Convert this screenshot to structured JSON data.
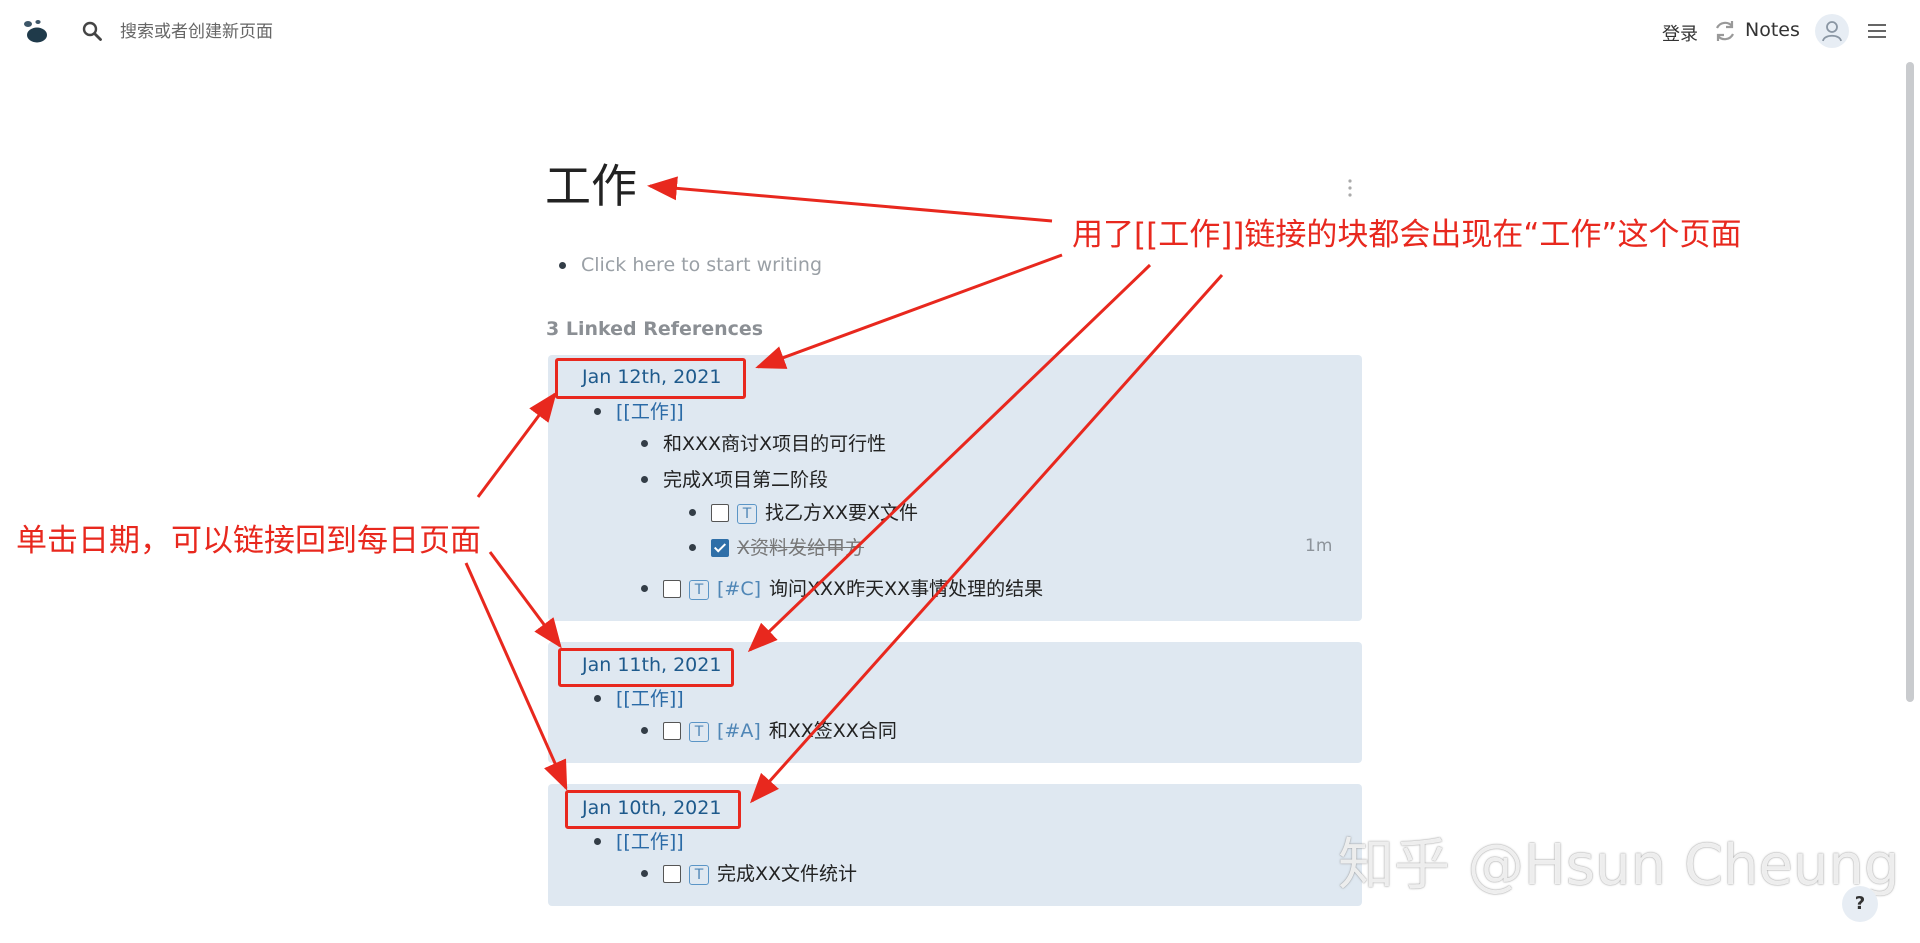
{
  "topbar": {
    "search_placeholder": "搜索或者创建新页面",
    "login": "登录",
    "notes": "Notes"
  },
  "page": {
    "title": "工作",
    "placeholder": "Click here to start writing",
    "refs_heading": "3 Linked References"
  },
  "references": [
    {
      "date": "Jan 12th, 2021",
      "parent": "[[工作]]",
      "items": [
        {
          "text": "和XXX商讨X项目的可行性"
        },
        {
          "text": "完成X项目第二阶段",
          "children": [
            {
              "marker": "T",
              "text": "找乙方XX要X文件",
              "checked": false
            },
            {
              "text": "X资料发给甲方",
              "checked": true,
              "time": "1m"
            }
          ]
        },
        {
          "marker": "T",
          "priority": "[#C]",
          "text": "询问XXX昨天XX事情处理的结果",
          "checked": false
        }
      ]
    },
    {
      "date": "Jan 11th, 2021",
      "parent": "[[工作]]",
      "items": [
        {
          "marker": "T",
          "priority": "[#A]",
          "text": "和XX签XX合同",
          "checked": false
        }
      ]
    },
    {
      "date": "Jan 10th, 2021",
      "parent": "[[工作]]",
      "items": [
        {
          "marker": "T",
          "text": "完成XX文件统计",
          "checked": false
        }
      ]
    }
  ],
  "annotations": {
    "right": "用了[[工作]]链接的块都会出现在“工作”这个页面",
    "left": "单击日期，可以链接回到每日页面",
    "color": "#e8281e"
  },
  "watermark": "知乎 @Hsun Cheung",
  "help": "?",
  "colors": {
    "card_bg": "#dfe8f1",
    "link": "#1e5a8c",
    "accent": "#2f6fa8"
  }
}
